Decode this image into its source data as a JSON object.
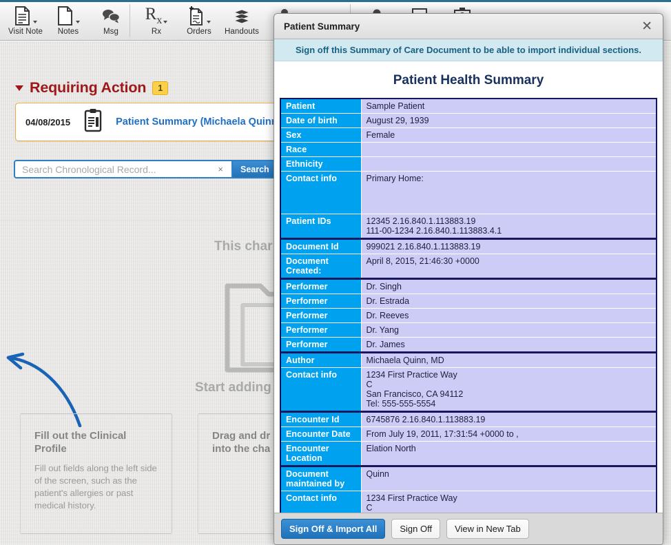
{
  "toolbar": {
    "items": [
      {
        "label": "Visit Note",
        "icon": "visit-note-icon",
        "caret": true
      },
      {
        "label": "Notes",
        "icon": "notes-icon",
        "caret": true
      },
      {
        "label": "Msg",
        "icon": "message-icon",
        "caret": false
      },
      {
        "label": "Rx",
        "icon": "prescription-icon",
        "caret": true
      },
      {
        "label": "Orders",
        "icon": "orders-icon",
        "caret": true
      },
      {
        "label": "Handouts",
        "icon": "handouts-icon",
        "caret": false
      }
    ]
  },
  "requiring_action": {
    "title": "Requiring Action",
    "count": "1",
    "row": {
      "date": "04/08/2015",
      "icon": "clipboard-icon",
      "link": "Patient Summary (Michaela Quinn)"
    }
  },
  "search": {
    "placeholder": "Search Chronological Record...",
    "clear_icon": "×",
    "button_label": "Search"
  },
  "empty_state": {
    "heading": "This char",
    "subheading": "Start adding",
    "folder_icon": "folder-icon",
    "arrow_icon": "curved-arrow-icon",
    "tips": [
      {
        "heading": "Fill out the Clinical Profile",
        "body": "Fill out fields along the left side of the screen, such as the patient's allergies or past medical history."
      },
      {
        "heading": "Drag and dr patient's CC into the cha",
        "body": ""
      }
    ]
  },
  "modal": {
    "title": "Patient Summary",
    "close_icon": "✕",
    "banner": "Sign off this Summary of Care Document to be able to import individual sections.",
    "doc_title": "Patient Health Summary",
    "colors": {
      "key_cell": "#00a2f0",
      "value_cell": "#ccccf7",
      "table_border": "#17175e",
      "banner_bg": "#d3e9f2",
      "primary_button": "#1f72bb"
    },
    "groups": [
      {
        "rows": [
          {
            "key": "Patient",
            "value": "Sample Patient"
          },
          {
            "key": "Date of birth",
            "value": "August 29, 1939"
          },
          {
            "key": "Sex",
            "value": "Female"
          },
          {
            "key": "Race",
            "value": ""
          },
          {
            "key": "Ethnicity",
            "value": ""
          },
          {
            "key": "Contact info",
            "value": "Primary Home:",
            "tall": "tall-contact"
          },
          {
            "key": "Patient IDs",
            "value": "12345 2.16.840.1.113883.19\n111-00-1234 2.16.840.1.113883.4.1"
          }
        ]
      },
      {
        "rows": [
          {
            "key": "Document Id",
            "value": "999021 2.16.840.1.113883.19"
          },
          {
            "key": "Document Created:",
            "value": "April 8, 2015, 21:46:30 +0000",
            "tall": "tall-2"
          }
        ]
      },
      {
        "rows": [
          {
            "key": "Performer",
            "value": "Dr. Singh"
          },
          {
            "key": "Performer",
            "value": "Dr. Estrada"
          },
          {
            "key": "Performer",
            "value": "Dr. Reeves"
          },
          {
            "key": "Performer",
            "value": "Dr. Yang"
          },
          {
            "key": "Performer",
            "value": "Dr. James"
          }
        ]
      },
      {
        "rows": [
          {
            "key": "Author",
            "value": "Michaela Quinn, MD"
          },
          {
            "key": "Contact info",
            "value": "1234 First Practice Way\nC\nSan Francisco, CA 94112\nTel: 555-555-5554"
          }
        ]
      },
      {
        "rows": [
          {
            "key": "Encounter Id",
            "value": "6745876 2.16.840.1.113883.19"
          },
          {
            "key": "Encounter Date",
            "value": " From July 19, 2011, 17:31:54 +0000 to ,"
          },
          {
            "key": "Encounter Location",
            "value": "Elation North",
            "tall": "tall-2"
          }
        ]
      },
      {
        "rows": [
          {
            "key": "Document maintained by",
            "value": "Quinn",
            "tall": "tall-2"
          },
          {
            "key": "Contact info",
            "value": "1234 First Practice Way\nC"
          }
        ]
      }
    ],
    "buttons": [
      {
        "label": "Sign Off & Import All",
        "style": "primary"
      },
      {
        "label": "Sign Off",
        "style": "plain"
      },
      {
        "label": "View in New Tab",
        "style": "plain"
      }
    ]
  }
}
